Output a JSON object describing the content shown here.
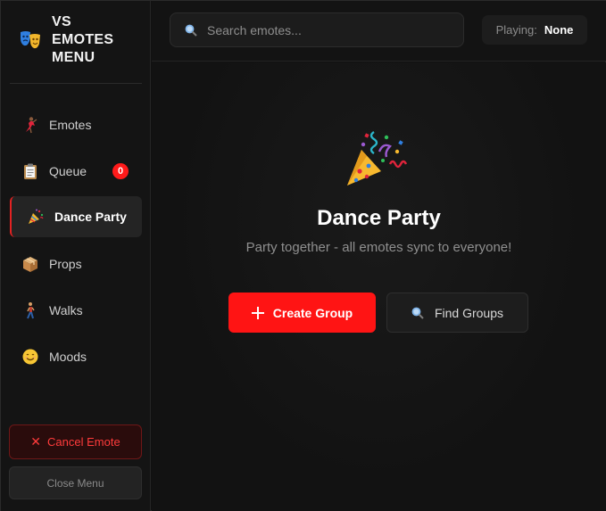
{
  "brand": {
    "title_line1": "VS",
    "title_line2": "EMOTES",
    "title_line3": "MENU",
    "icon": "theater-masks-icon"
  },
  "sidebar": {
    "items": [
      {
        "label": "Emotes",
        "icon": "dancer-icon",
        "active": false
      },
      {
        "label": "Queue",
        "icon": "clipboard-icon",
        "active": false,
        "badge": "0"
      },
      {
        "label": "Dance Party",
        "icon": "party-popper-icon",
        "active": true
      },
      {
        "label": "Props",
        "icon": "box-icon",
        "active": false
      },
      {
        "label": "Walks",
        "icon": "walking-person-icon",
        "active": false
      },
      {
        "label": "Moods",
        "icon": "smiley-icon",
        "active": false
      }
    ],
    "cancel_label": "Cancel Emote",
    "close_label": "Close Menu"
  },
  "header": {
    "search_placeholder": "Search emotes...",
    "playing_label": "Playing:",
    "playing_value": "None"
  },
  "main": {
    "title": "Dance Party",
    "subtitle": "Party together - all emotes sync to everyone!",
    "create_label": "Create Group",
    "find_label": "Find Groups"
  },
  "colors": {
    "accent": "#ff1414",
    "badge": "#ff1a1a",
    "active_border": "#e32222"
  }
}
